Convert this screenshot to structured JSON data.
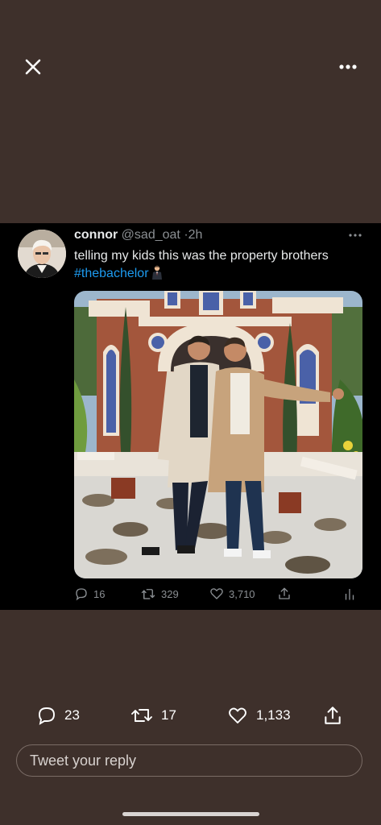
{
  "tweet": {
    "display_name": "connor",
    "handle": "@sad_oat",
    "separator": "·",
    "time": "2h",
    "text": "telling my kids this was the property brothers",
    "hashtag": "#thebachelor",
    "inline_stats": {
      "replies": "16",
      "retweets": "329",
      "likes": "3,710"
    }
  },
  "footer": {
    "replies": "23",
    "retweets": "17",
    "likes": "1,133",
    "reply_placeholder": "Tweet your reply"
  },
  "icons": {
    "close": "close-icon",
    "more": "more-icon",
    "reply": "reply-icon",
    "retweet": "retweet-icon",
    "like": "heart-icon",
    "share": "share-icon",
    "analytics": "analytics-icon"
  },
  "colors": {
    "background": "#3e302b",
    "card": "#000000",
    "link": "#1d9bf0",
    "muted": "#8b8f93"
  }
}
